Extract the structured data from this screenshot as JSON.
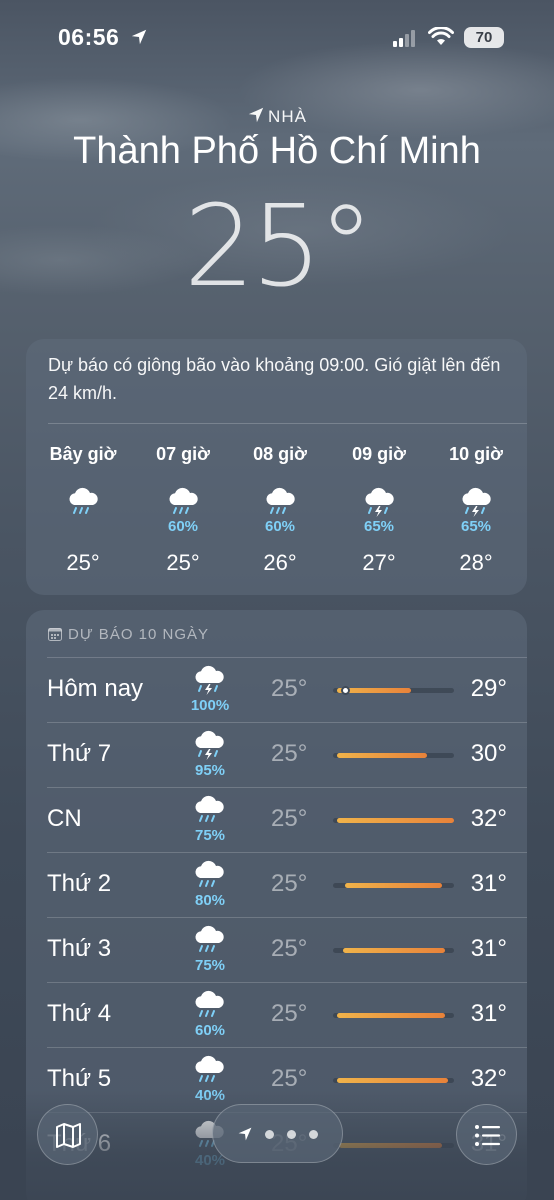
{
  "status_bar": {
    "time": "06:56",
    "battery": "70"
  },
  "location": {
    "label": "NHÀ",
    "city": "Thành Phố Hồ Chí Minh",
    "current_temp": "25°"
  },
  "hourly": {
    "summary": "Dự báo có giông bão vào khoảng 09:00. Gió giật lên đến 24 km/h.",
    "items": [
      {
        "label": "Bây giờ",
        "icon": "rain-cloud-icon",
        "pct": "",
        "temp": "25°"
      },
      {
        "label": "07 giờ",
        "icon": "rain-cloud-icon",
        "pct": "60%",
        "temp": "25°"
      },
      {
        "label": "08 giờ",
        "icon": "rain-cloud-icon",
        "pct": "60%",
        "temp": "26°"
      },
      {
        "label": "09 giờ",
        "icon": "thunderstorm-icon",
        "pct": "65%",
        "temp": "27°"
      },
      {
        "label": "10 giờ",
        "icon": "thunderstorm-icon",
        "pct": "65%",
        "temp": "28°"
      }
    ]
  },
  "daily": {
    "header": "DỰ BÁO 10 NGÀY",
    "days": [
      {
        "name": "Hôm nay",
        "icon": "thunderstorm-icon",
        "pct": "100%",
        "low": "25°",
        "high": "29°",
        "range_start": 0.03,
        "range_end": 0.64,
        "current": 0.1
      },
      {
        "name": "Thứ 7",
        "icon": "thunderstorm-icon",
        "pct": "95%",
        "low": "25°",
        "high": "30°",
        "range_start": 0.03,
        "range_end": 0.77
      },
      {
        "name": "CN",
        "icon": "rain-cloud-icon",
        "pct": "75%",
        "low": "25°",
        "high": "32°",
        "range_start": 0.03,
        "range_end": 1.0
      },
      {
        "name": "Thứ 2",
        "icon": "rain-cloud-icon",
        "pct": "80%",
        "low": "25°",
        "high": "31°",
        "range_start": 0.1,
        "range_end": 0.9
      },
      {
        "name": "Thứ 3",
        "icon": "rain-cloud-icon",
        "pct": "75%",
        "low": "25°",
        "high": "31°",
        "range_start": 0.08,
        "range_end": 0.92
      },
      {
        "name": "Thứ 4",
        "icon": "rain-cloud-icon",
        "pct": "60%",
        "low": "25°",
        "high": "31°",
        "range_start": 0.03,
        "range_end": 0.92
      },
      {
        "name": "Thứ 5",
        "icon": "rain-cloud-icon",
        "pct": "40%",
        "low": "25°",
        "high": "32°",
        "range_start": 0.03,
        "range_end": 0.95
      },
      {
        "name": "Thứ 6",
        "icon": "rain-cloud-icon",
        "pct": "40%",
        "low": "25°",
        "high": "31°",
        "range_start": 0.05,
        "range_end": 0.9
      }
    ]
  },
  "colors": {
    "precip": "#7fd0f7",
    "bar_start": "#f0b34a",
    "bar_end": "#e8823a"
  }
}
